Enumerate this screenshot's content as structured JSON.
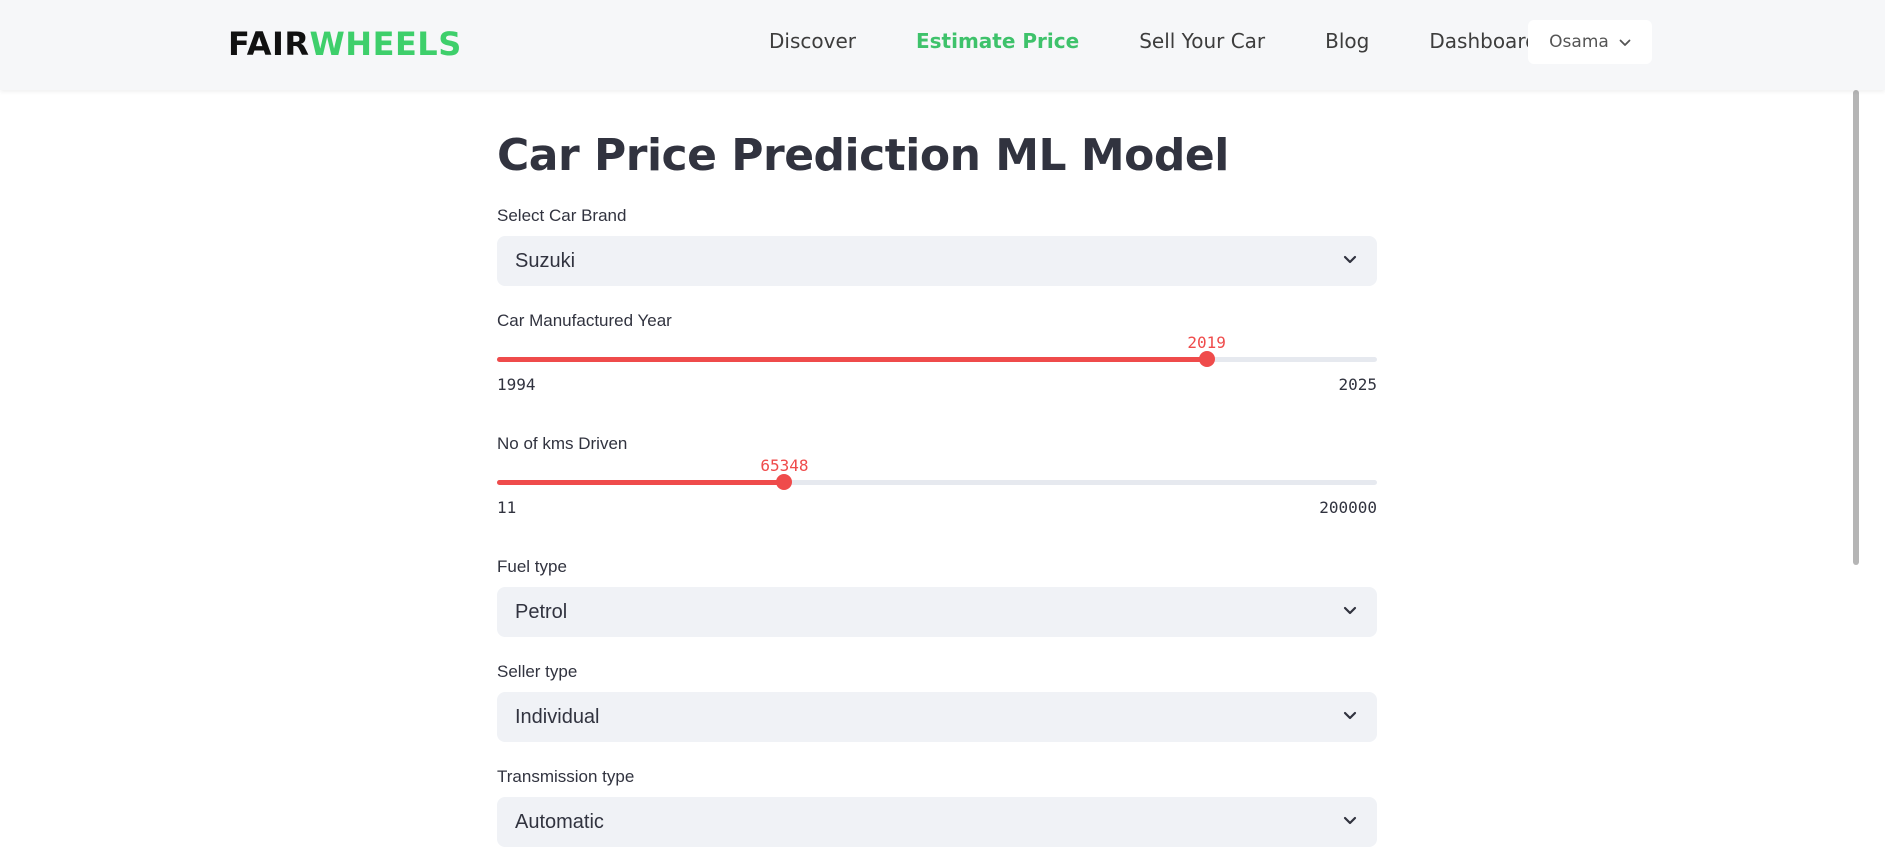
{
  "nav": {
    "logo_part1": "FAIR",
    "logo_part2": "WHEELS",
    "links": [
      "Discover",
      "Estimate Price",
      "Sell Your Car",
      "Blog",
      "Dashboard"
    ],
    "active_link": "Estimate Price",
    "user": "Osama"
  },
  "page": {
    "title": "Car Price Prediction ML Model"
  },
  "form": {
    "brand": {
      "label": "Select Car Brand",
      "value": "Suzuki"
    },
    "year": {
      "label": "Car Manufactured Year",
      "value": 2019,
      "min": 1994,
      "max": 2025
    },
    "kms": {
      "label": "No of kms Driven",
      "value": 65348,
      "min": 11,
      "max": 200000
    },
    "fuel": {
      "label": "Fuel type",
      "value": "Petrol"
    },
    "seller": {
      "label": "Seller type",
      "value": "Individual"
    },
    "transmission": {
      "label": "Transmission type",
      "value": "Automatic"
    }
  },
  "colors": {
    "accent": "#ef4b4b",
    "brand_green": "#3ecf6b",
    "input_bg": "#f0f2f6"
  }
}
